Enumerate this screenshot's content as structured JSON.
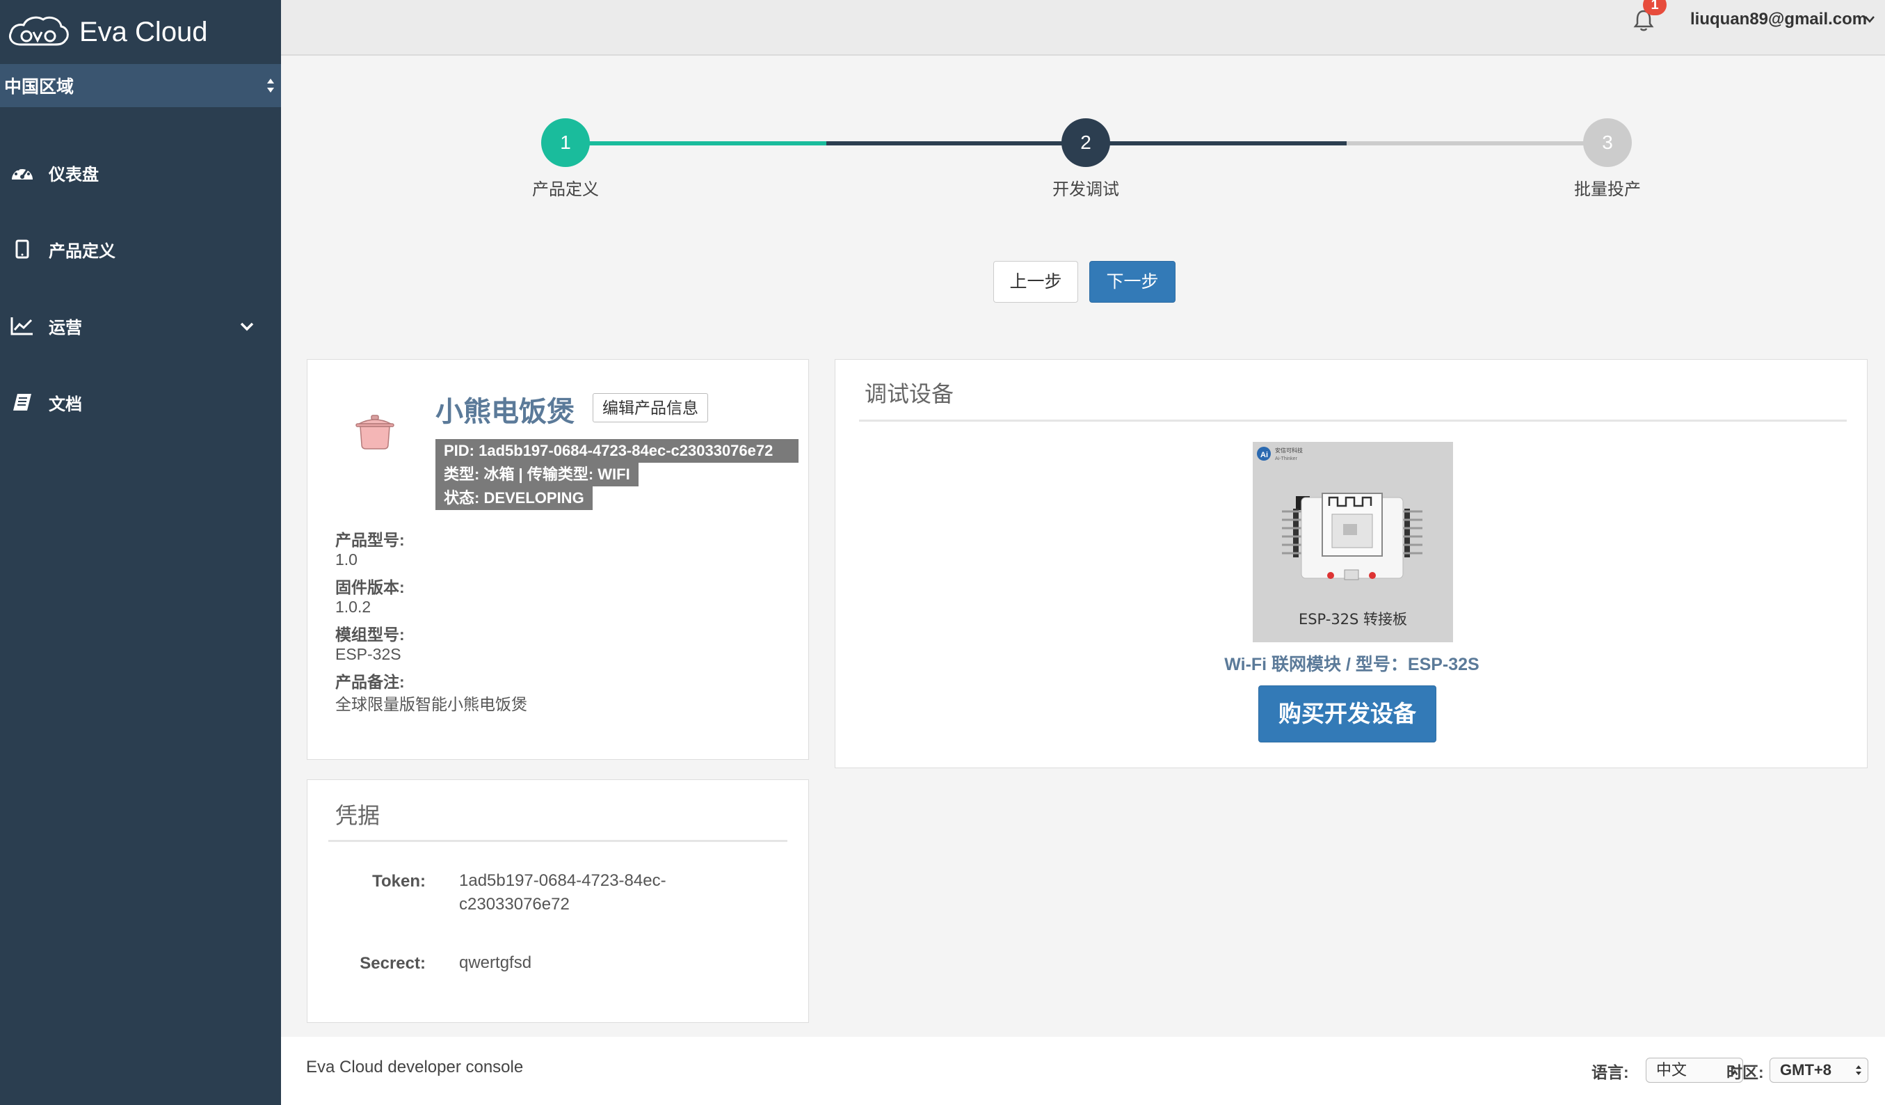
{
  "brand": {
    "name": "Eva Cloud",
    "logo_icon": "eva-cloud-logo"
  },
  "region": {
    "label": "中国区域"
  },
  "sidebar": {
    "items": [
      {
        "label": "仪表盘",
        "icon": "dashboard-icon"
      },
      {
        "label": "产品定义",
        "icon": "tablet-icon"
      },
      {
        "label": "运营",
        "icon": "line-chart-icon",
        "expandable": true
      },
      {
        "label": "文档",
        "icon": "book-icon"
      }
    ]
  },
  "header": {
    "notification_count": "1",
    "user_email": "liuquan89@gmail.com"
  },
  "stepper": {
    "steps": [
      {
        "number": "1",
        "label": "产品定义"
      },
      {
        "number": "2",
        "label": "开发调试"
      },
      {
        "number": "3",
        "label": "批量投产"
      }
    ],
    "active_step": 2,
    "colors": {
      "done": "#1abc9c",
      "active": "#2c3e50",
      "pending": "#cccccc"
    }
  },
  "actions": {
    "prev_label": "上一步",
    "next_label": "下一步"
  },
  "product": {
    "name": "小熊电饭煲",
    "edit_label": "编辑产品信息",
    "pid_line": "PID: 1ad5b197-0684-4723-84ec-c23033076e72",
    "type_line": "类型: 冰箱  |  传输类型: WIFI",
    "status_line": "状态: DEVELOPING",
    "specs": [
      {
        "label": "产品型号:",
        "value": "1.0"
      },
      {
        "label": "固件版本:",
        "value": "1.0.2"
      },
      {
        "label": "模组型号:",
        "value": "ESP-32S"
      },
      {
        "label": "产品备注:",
        "value": "全球限量版智能小熊电饭煲"
      }
    ]
  },
  "credentials": {
    "title": "凭据",
    "token_label": "Token:",
    "token_line1": "1ad5b197-0684-4723-84ec-",
    "token_line2": "c23033076e72",
    "secret_label": "Secrect:",
    "secret_value": "qwertgfsd"
  },
  "debug": {
    "title": "调试设备",
    "image_brand": "安信可科技",
    "image_brand_en": "Ai-Thinker",
    "image_caption": "ESP-32S 转接板",
    "device_caption": "Wi-Fi 联网模块 / 型号：ESP-32S",
    "buy_label": "购买开发设备"
  },
  "footer": {
    "text": "Eva Cloud developer console",
    "lang_label": "语言:",
    "lang_value": "中文",
    "tz_label": "时区:",
    "tz_value": "GMT+8"
  }
}
